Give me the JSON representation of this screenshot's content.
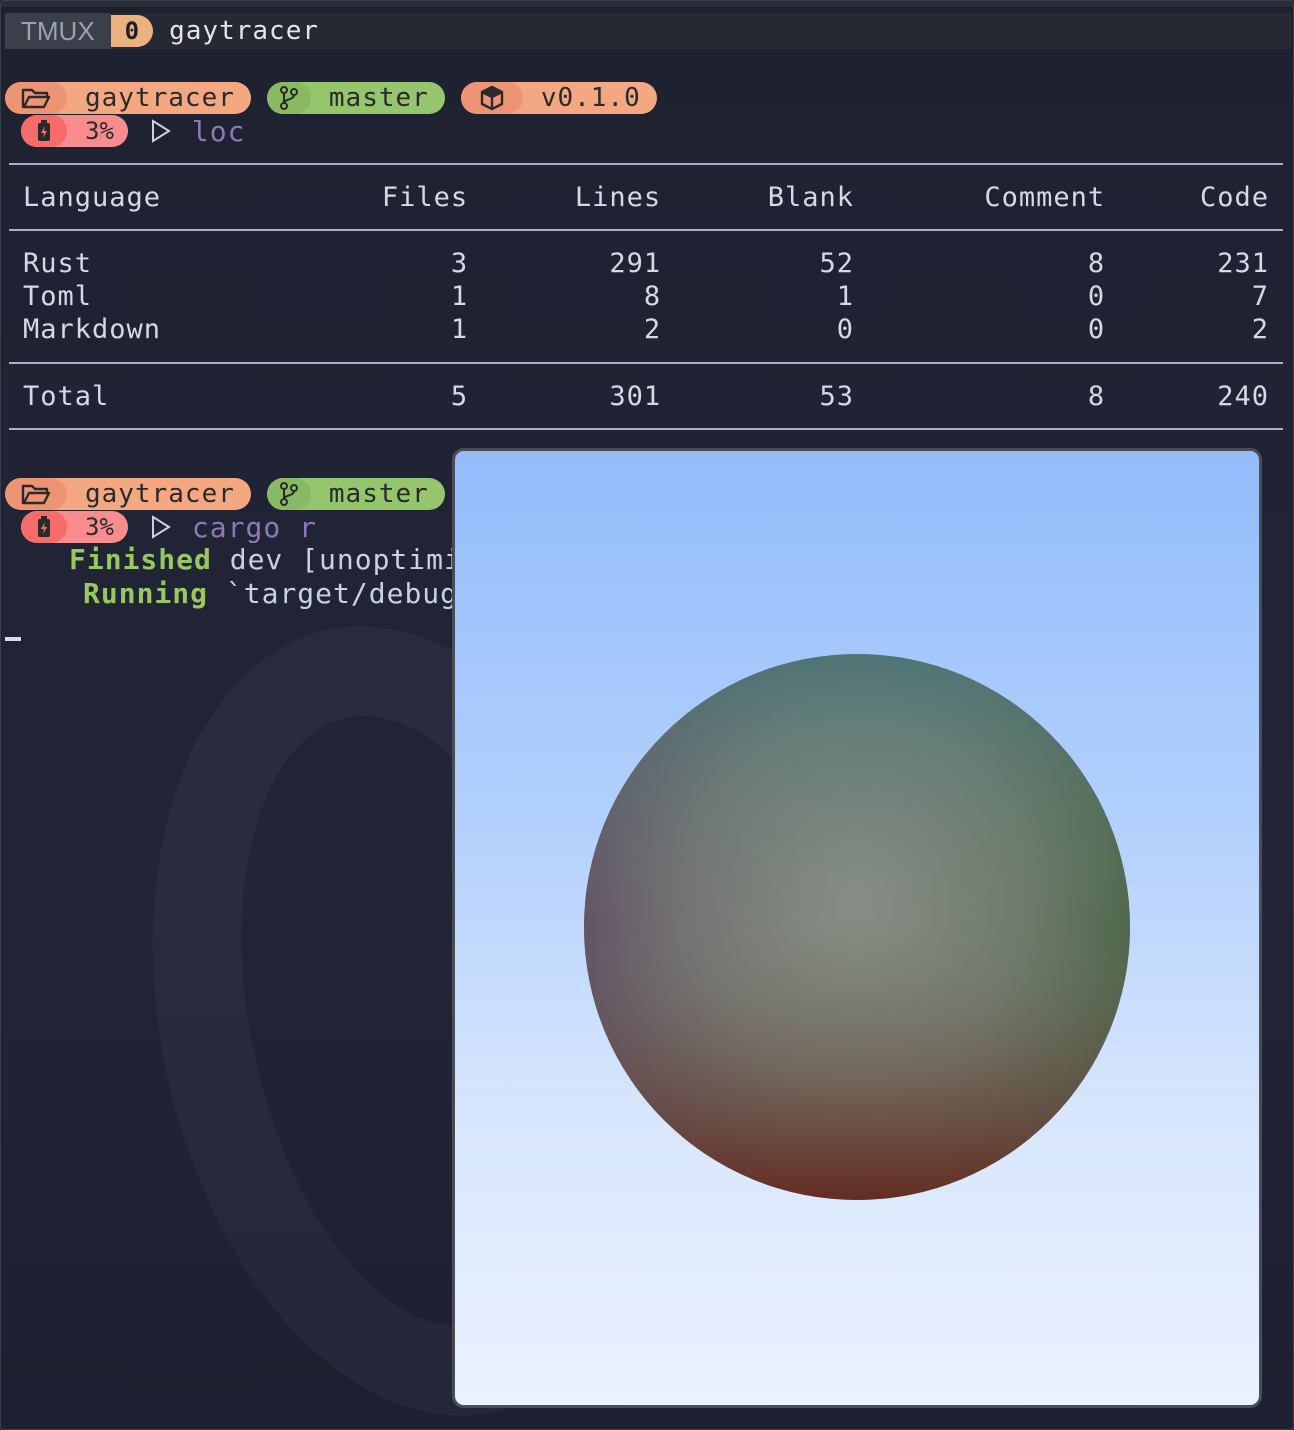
{
  "tmux": {
    "label": "TMUX",
    "window_index": "0",
    "session_name": "gaytracer"
  },
  "prompt1": {
    "dir": "gaytracer",
    "branch": "master",
    "version": "v0.1.0",
    "battery": "3%",
    "command": "loc"
  },
  "loc_table": {
    "headers": [
      "Language",
      "Files",
      "Lines",
      "Blank",
      "Comment",
      "Code"
    ],
    "rows": [
      [
        "Rust",
        "3",
        "291",
        "52",
        "8",
        "231"
      ],
      [
        "Toml",
        "1",
        "8",
        "1",
        "0",
        "7"
      ],
      [
        "Markdown",
        "1",
        "2",
        "0",
        "0",
        "2"
      ]
    ],
    "total": [
      "Total",
      "5",
      "301",
      "53",
      "8",
      "240"
    ]
  },
  "prompt2": {
    "dir": "gaytracer",
    "branch": "master",
    "battery": "3%",
    "command": "cargo r"
  },
  "output": {
    "finished_label": "Finished",
    "finished_text": " dev [unoptimize",
    "running_label": "Running",
    "running_text": " `target/debug/w"
  },
  "colors": {
    "background": "#1f2230",
    "dir_pill": "#f4a882",
    "git_pill": "#95c56d",
    "battery_pill": "#f98c8c",
    "command": "#8e79b8",
    "success": "#98c65f",
    "sky_top": "#93bcfb",
    "sky_bottom": "#eaf2fe"
  },
  "icons": {
    "dir": "folder-open-icon",
    "git": "git-branch-icon",
    "package": "package-icon",
    "battery": "battery-charging-icon",
    "prompt": "play-arrow-icon"
  }
}
